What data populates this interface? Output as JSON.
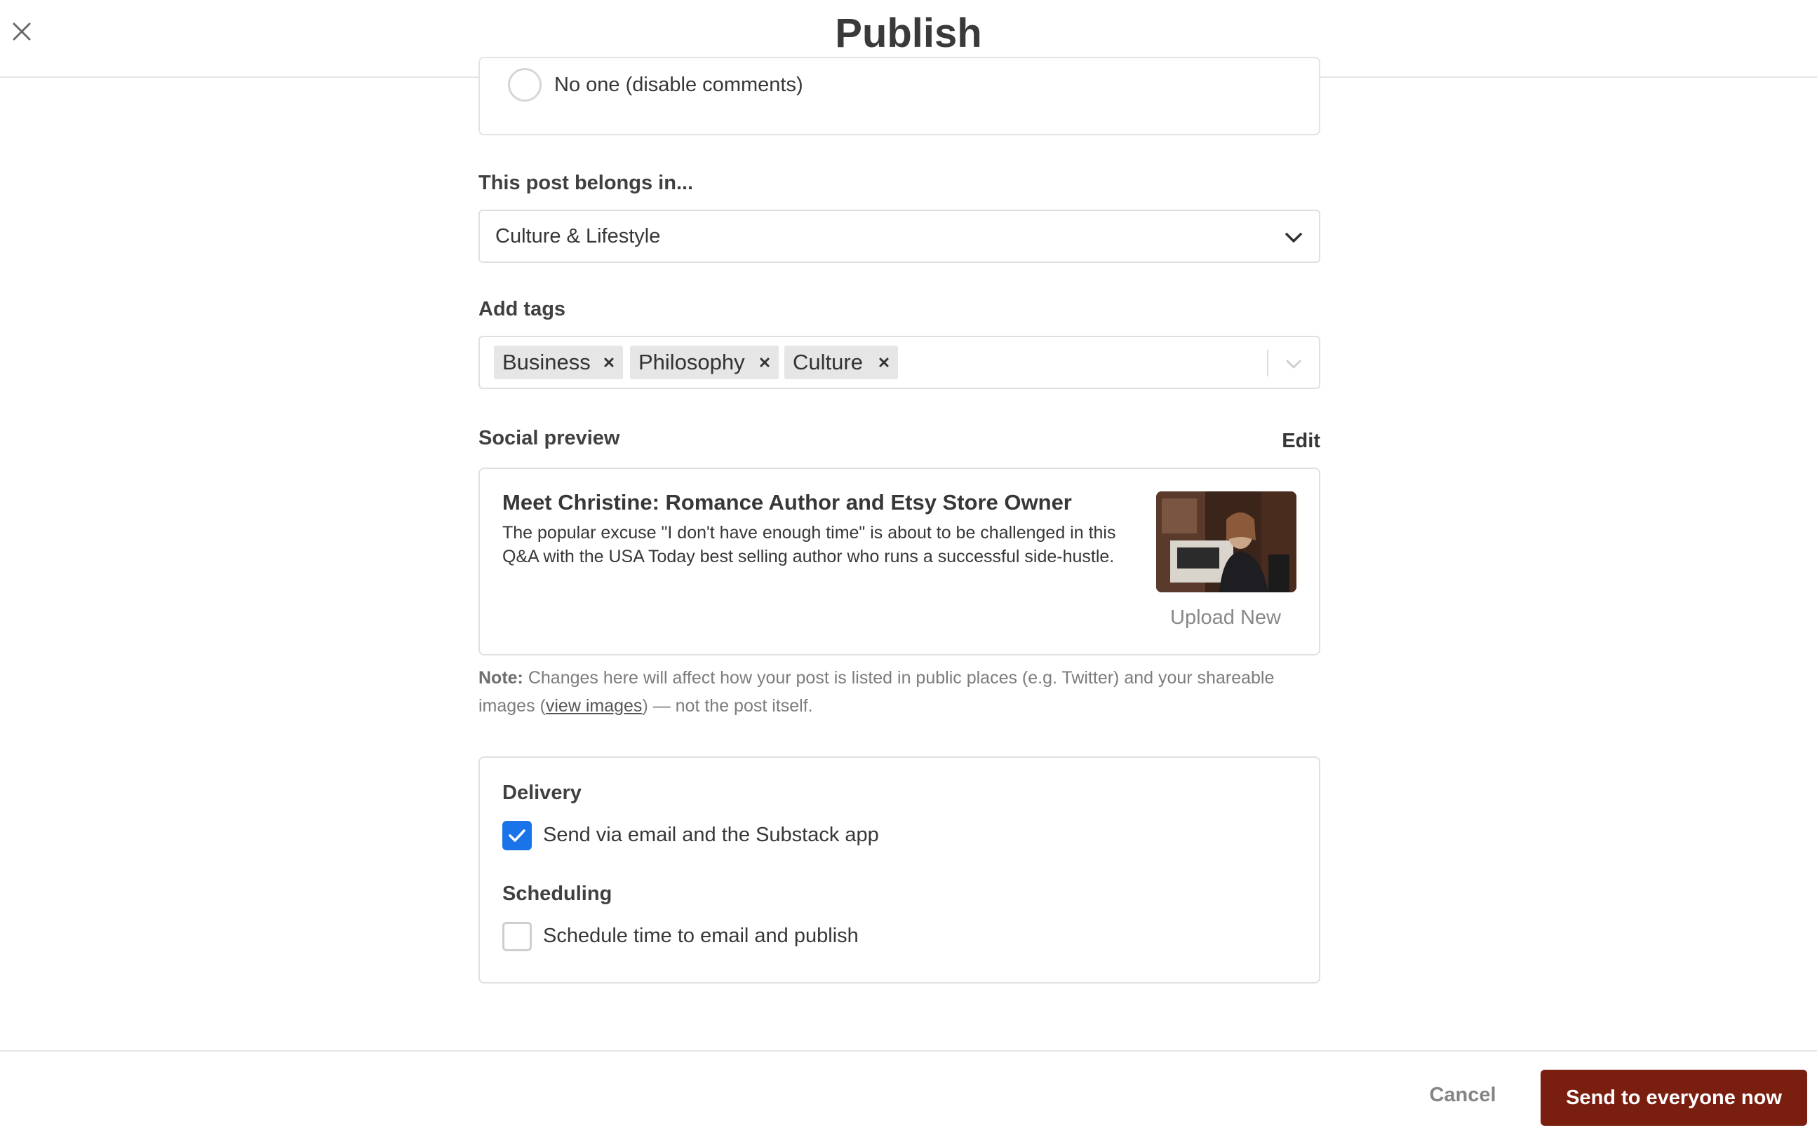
{
  "header": {
    "title": "Publish",
    "close_icon": "close-icon"
  },
  "comments": {
    "option_label": "No one (disable comments)"
  },
  "category": {
    "label": "This post belongs in...",
    "selected": "Culture & Lifestyle"
  },
  "tags": {
    "label": "Add tags",
    "items": [
      "Business",
      "Philosophy",
      "Culture"
    ]
  },
  "social_preview": {
    "label": "Social preview",
    "edit_label": "Edit",
    "title": "Meet Christine: Romance Author and Etsy Store Owner",
    "description": "The popular excuse \"I don't have enough time\" is about to be challenged in this Q&A with the USA Today best selling author who runs a successful side-hustle.",
    "upload_label": "Upload New"
  },
  "note": {
    "bold": "Note:",
    "text_before": " Changes here will affect how your post is listed in public places (e.g. Twitter) and your shareable images (",
    "link": "view images",
    "text_after": ") — not the post itself."
  },
  "delivery": {
    "heading": "Delivery",
    "option_label": "Send via email and the Substack app",
    "checked": true
  },
  "scheduling": {
    "heading": "Scheduling",
    "option_label": "Schedule time to email and publish",
    "checked": false
  },
  "footer": {
    "cancel_label": "Cancel",
    "send_label": "Send to everyone now"
  },
  "colors": {
    "accent": "#1a73e8",
    "primary_button": "#7a1e10"
  }
}
